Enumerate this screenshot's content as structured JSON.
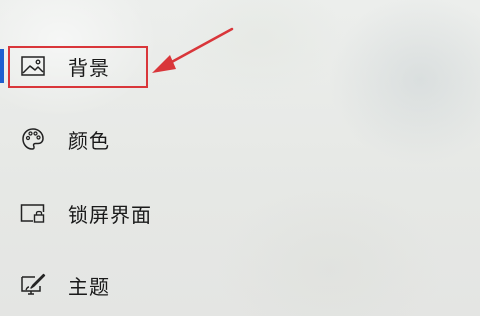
{
  "settings_nav": {
    "items": [
      {
        "label": "背景",
        "icon": "picture-icon",
        "selected": true
      },
      {
        "label": "颜色",
        "icon": "palette-icon",
        "selected": false
      },
      {
        "label": "锁屏界面",
        "icon": "lock-screen-icon",
        "selected": false
      },
      {
        "label": "主题",
        "icon": "theme-brush-icon",
        "selected": false
      }
    ]
  },
  "colors": {
    "accent": "#1f5fd0",
    "annotation": "#d9363a",
    "text": "#1a1a1a"
  }
}
